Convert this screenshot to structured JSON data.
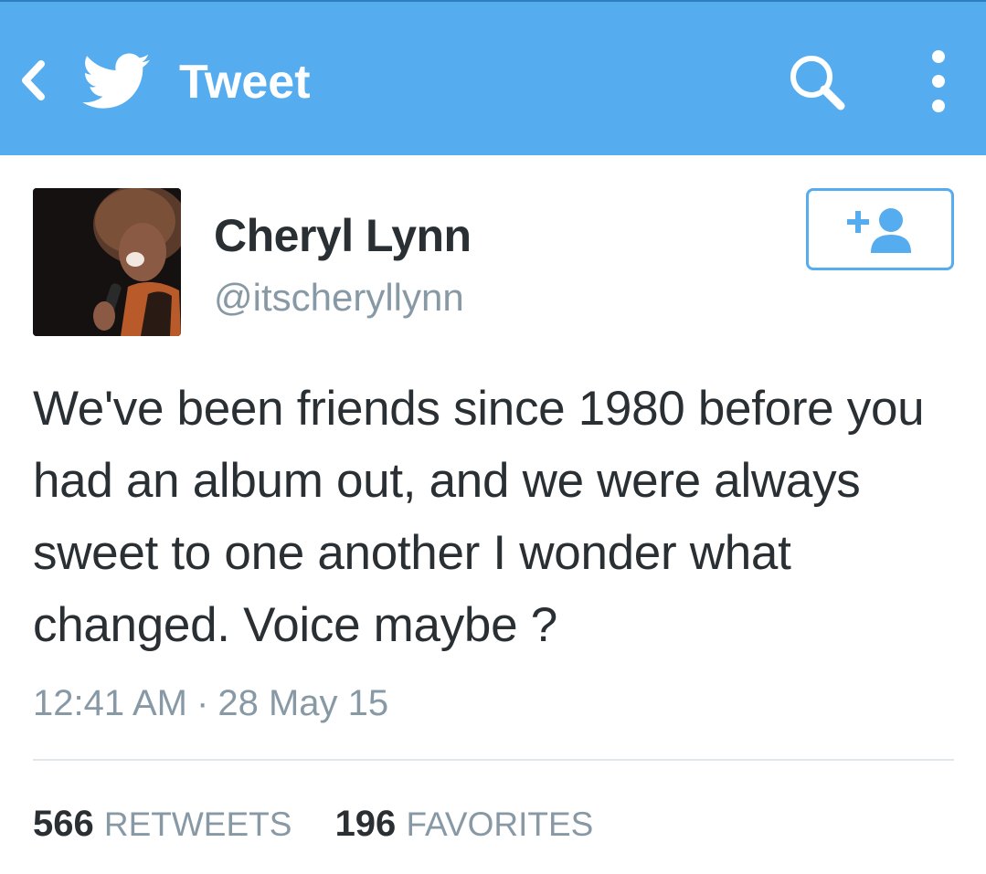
{
  "topbar": {
    "title": "Tweet",
    "color": "#55acee",
    "icons": [
      "back-chevron-icon",
      "twitter-bird-icon",
      "search-icon",
      "more-vertical-icon"
    ]
  },
  "user": {
    "name": "Cheryl Lynn",
    "handle": "@itscheryllynn"
  },
  "tweet": {
    "text": "We've been friends since 1980 before you had an album out, and we were always sweet to one another I wonder what changed. Voice maybe ?",
    "time": "12:41 AM",
    "separator": "·",
    "date": "28 May 15"
  },
  "stats": {
    "retweets_count": "566",
    "retweets_label": "RETWEETS",
    "favorites_count": "196",
    "favorites_label": "FAVORITES"
  },
  "follow_button": {
    "icon": "add-user-icon",
    "accent": "#55acee"
  }
}
